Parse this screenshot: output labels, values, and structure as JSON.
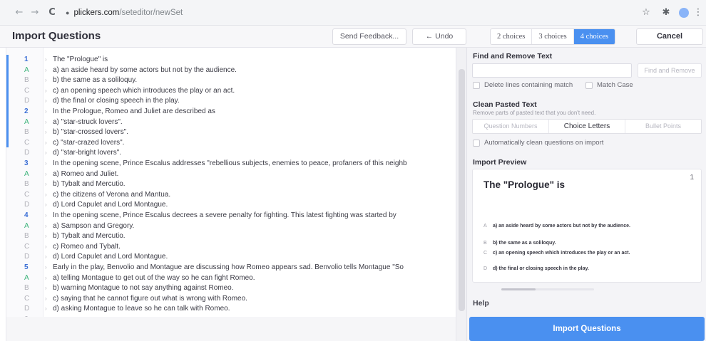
{
  "browser": {
    "back_icon": "←",
    "forward_icon": "→",
    "reload_icon": "C",
    "lock_icon": "lock-icon",
    "url_host": "plickers.com",
    "url_path": "/seteditor/newSet",
    "star_icon": "☆",
    "puzzle_icon": "✱",
    "menu_icon": "⋮"
  },
  "header": {
    "title": "Import Questions",
    "send_feedback": "Send Feedback...",
    "undo": "← Undo",
    "choices": [
      "2 choices",
      "3 choices",
      "4 choices"
    ],
    "active_choice_index": 2,
    "cancel": "Cancel"
  },
  "editor": {
    "lines": [
      {
        "num": "1",
        "kind": "q",
        "text": "The \"Prologue\" is"
      },
      {
        "num": "A",
        "kind": "a",
        "text": "a) an aside heard by some actors but not by the audience."
      },
      {
        "num": "B",
        "kind": "o",
        "text": "b) the same as a soliloquy."
      },
      {
        "num": "C",
        "kind": "o",
        "text": "c) an opening speech which introduces the play or an act."
      },
      {
        "num": "D",
        "kind": "o",
        "text": "d) the final or closing speech in the play."
      },
      {
        "num": "2",
        "kind": "q",
        "text": "In the Prologue, Romeo and Juliet are described as"
      },
      {
        "num": "A",
        "kind": "a",
        "text": "a) \"star-struck lovers\"."
      },
      {
        "num": "B",
        "kind": "o",
        "text": "b) \"star-crossed lovers\"."
      },
      {
        "num": "C",
        "kind": "o",
        "text": "c) \"star-crazed lovers\"."
      },
      {
        "num": "D",
        "kind": "o",
        "text": "d) \"star-bright lovers\"."
      },
      {
        "num": "3",
        "kind": "q",
        "text": "In the opening scene, Prince Escalus addresses \"rebellious subjects, enemies to peace, profaners of this neighb"
      },
      {
        "num": "A",
        "kind": "a",
        "text": "a) Romeo and Juliet."
      },
      {
        "num": "B",
        "kind": "o",
        "text": "b) Tybalt and Mercutio."
      },
      {
        "num": "C",
        "kind": "o",
        "text": "c) the citizens of Verona and Mantua."
      },
      {
        "num": "D",
        "kind": "o",
        "text": "d) Lord Capulet and Lord Montague."
      },
      {
        "num": "4",
        "kind": "q",
        "text": "In the opening scene, Prince Escalus decrees a severe penalty for fighting. This latest fighting was started by"
      },
      {
        "num": "A",
        "kind": "a",
        "text": "a) Sampson and Gregory."
      },
      {
        "num": "B",
        "kind": "o",
        "text": "b) Tybalt and Mercutio."
      },
      {
        "num": "C",
        "kind": "o",
        "text": "c) Romeo and Tybalt."
      },
      {
        "num": "D",
        "kind": "o",
        "text": "d) Lord Capulet and Lord Montague."
      },
      {
        "num": "5",
        "kind": "q",
        "text": "Early in the play, Benvolio and Montague are discussing how Romeo appears sad. Benvolio tells Montague \"So"
      },
      {
        "num": "A",
        "kind": "a",
        "text": "a) telling Montague to get out of the way so he can fight Romeo."
      },
      {
        "num": "B",
        "kind": "o",
        "text": "b) warning Montague to not say anything against Romeo."
      },
      {
        "num": "C",
        "kind": "o",
        "text": "c) saying that he cannot figure out what is wrong with Romeo."
      },
      {
        "num": "D",
        "kind": "o",
        "text": "d) asking Montague to leave so he can talk with Romeo."
      },
      {
        "num": "6",
        "kind": "o",
        "text": ""
      },
      {
        "num": "A",
        "kind": "o",
        "text": ""
      }
    ]
  },
  "panel": {
    "find_title": "Find and Remove Text",
    "find_button": "Find and Remove",
    "delete_lines": "Delete lines containing match",
    "match_case": "Match Case",
    "clean_title": "Clean Pasted Text",
    "clean_subtitle": "Remove parts of pasted text that you don't need.",
    "clean_options": [
      "Question Numbers",
      "Choice Letters",
      "Bullet Points"
    ],
    "clean_active_index": 1,
    "auto_clean": "Automatically clean questions on import",
    "preview_title": "Import Preview",
    "preview": {
      "number": "1",
      "question": "The \"Prologue\" is",
      "answers": [
        {
          "letter": "A",
          "text": "a) an aside heard by some actors but not by the audience."
        },
        {
          "letter": "B",
          "text": "b) the same as a soliloquy."
        },
        {
          "letter": "C",
          "text": "c) an opening speech which introduces the play or an act."
        },
        {
          "letter": "D",
          "text": "d) the final or closing speech in the play."
        }
      ]
    },
    "help": "Help",
    "import_button": "Import Questions"
  },
  "colors": {
    "accent": "#4a90f0",
    "correct": "#3bb37a",
    "question_number": "#3b6fd6"
  }
}
